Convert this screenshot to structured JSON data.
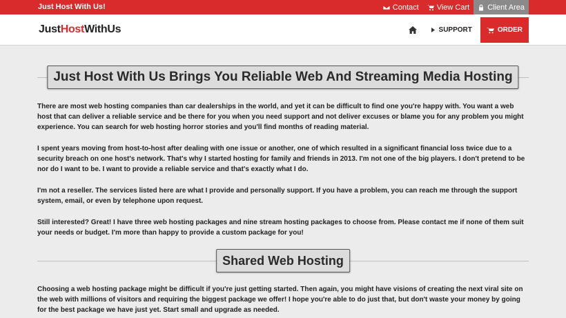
{
  "topbar": {
    "tagline": "Just Host With Us!",
    "links": {
      "contact": "Contact",
      "cart": "View Cart",
      "client": "Client Area"
    }
  },
  "header": {
    "logo": {
      "part1": "Just",
      "part2": "Host",
      "part3": "WithUs"
    },
    "nav": {
      "support": "SUPPORT",
      "order": "ORDER"
    }
  },
  "main": {
    "heading": "Just Host With Us Brings You Reliable Web And Streaming Media Hosting",
    "paragraphs": [
      "There are most web hosting companies than car dealerships in the world, and yet it can be difficult to find one you're happy with. You want a web host that can deliver a reliable service and be there for you when you need support and not deliver excuses or blame you for any problem you might experience. You can search for web hosting horror stories and you'll find months of reading material.",
      "I spent years moving from host-to-host after dealing with one issue or another, one of which resulted in a significant financial loss twice due to a security breach on one host's network. That's why I started hosting for family and friends in 2013. I'm not one of the big players. I don't pretend to be nor do I want to be. I want to provide a reliable service and that's exactly what I do.",
      "I'm not a reseller. The services listed here are what I provide and personally support. If you have a problem, you can reach me through the support system, email, or even by telephone upon request.",
      "Still interested? Great! I have three web hosting packages and nine stream hosting packages to choose from. Please contact me if none of them suit your needs or budget. I'm more than happy to provide a custom package for you!"
    ],
    "shared_heading": "Shared Web Hosting",
    "shared_paragraph": "Choosing a web hosting package might be difficult if you're just getting started. Then again, you might have visions of creating the next viral site on the web with millions of visitors and requiring the biggest package we offer! I hope you're able to do just that, but don't waste your money by going for the best package we have just yet. Start small and upgrade as needed."
  },
  "colors": {
    "brand_red": "#d92b2b",
    "client_area_bg": "#8a8a8a",
    "page_bg": "#ececec"
  },
  "icons": {
    "contact": "envelope-icon",
    "cart": "cart-icon",
    "client": "lock-icon",
    "home": "home-icon",
    "support": "chevron-right-icon",
    "order": "cart-icon"
  }
}
